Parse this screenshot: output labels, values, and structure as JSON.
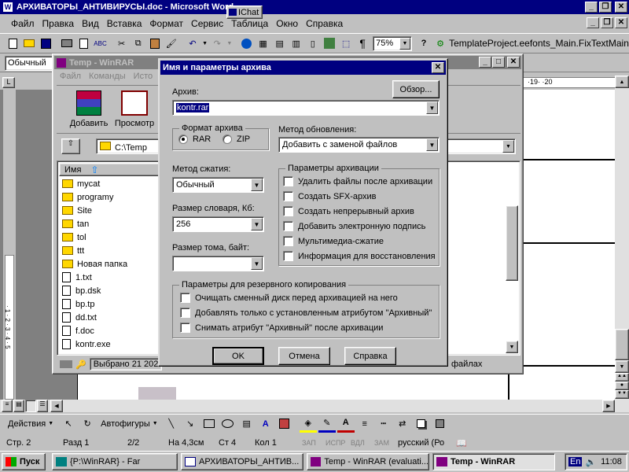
{
  "word": {
    "title": "АРХИВАТОРЫ_АНТИВИРУСЫ.doc - Microsoft Word",
    "menu": [
      "Файл",
      "Правка",
      "Вид",
      "Вставка",
      "Формат",
      "Сервис",
      "Таблица",
      "Окно",
      "Справка"
    ],
    "zoom": "75%",
    "macro": "TemplateProject.eefonts_Main.FixTextMain",
    "style": "Обычный",
    "ruler_marks": "·19·  ·20",
    "draw_label": "Действия",
    "autoshapes": "Автофигуры",
    "status": {
      "page": "Стр. 2",
      "section": "Разд 1",
      "pages": "2/2",
      "pos": "На 4,3см",
      "line": "Ст 4",
      "col": "Кол 1",
      "zap": "ЗАП",
      "ispr": "ИСПР",
      "vdl": "ВДЛ",
      "zam": "ЗАМ",
      "lang": "русский (Ро"
    }
  },
  "ichat": "IChat",
  "winrar": {
    "title": "Temp - WinRAR",
    "menu": [
      "Файл",
      "Команды",
      "Исто"
    ],
    "toolbar": [
      "Добавить",
      "Просмотр"
    ],
    "path": "C:\\Temp",
    "column_name": "Имя",
    "files": [
      {
        "name": "mycat",
        "type": "folder"
      },
      {
        "name": "programy",
        "type": "folder"
      },
      {
        "name": "Site",
        "type": "folder"
      },
      {
        "name": "tan",
        "type": "folder"
      },
      {
        "name": "tol",
        "type": "folder"
      },
      {
        "name": "ttt",
        "type": "folder"
      },
      {
        "name": "Новая папка",
        "type": "folder"
      },
      {
        "name": "1.txt",
        "type": "file"
      },
      {
        "name": "bp.dsk",
        "type": "file"
      },
      {
        "name": "bp.tp",
        "type": "file"
      },
      {
        "name": "dd.txt",
        "type": "file"
      },
      {
        "name": "f.doc",
        "type": "doc"
      },
      {
        "name": "kontr.exe",
        "type": "exe"
      }
    ],
    "status_left": "Выбрано 21 202",
    "status_right": "файлах"
  },
  "dialog": {
    "title": "Имя и параметры архива",
    "archive_label": "Архив:",
    "browse": "Обзор...",
    "archive_value": "kontr.rar",
    "format_group": "Формат архива",
    "format_rar": "RAR",
    "format_zip": "ZIP",
    "update_label": "Метод обновления:",
    "update_value": "Добавить с заменой файлов",
    "compression_label": "Метод сжатия:",
    "compression_value": "Обычный",
    "dict_label": "Размер словаря, Кб:",
    "dict_value": "256",
    "volume_label": "Размер тома, байт:",
    "volume_value": "",
    "options_group": "Параметры архивации",
    "options": [
      "Удалить файлы после архивации",
      "Создать SFX-архив",
      "Создать непрерывный архив",
      "Добавить электронную подпись",
      "Мультимедиа-сжатие",
      "Информация для восстановления"
    ],
    "backup_group": "Параметры для резервного копирования",
    "backup_options": [
      "Очищать сменный диск перед архивацией на него",
      "Добавлять только с установленным атрибутом \"Архивный\"",
      "Снимать атрибут \"Архивный\" после архивации"
    ],
    "ok": "OK",
    "cancel": "Отмена",
    "help": "Справка"
  },
  "taskbar": {
    "start": "Пуск",
    "items": [
      "{P:\\WinRAR} - Far",
      "АРХИВАТОРЫ_АНТИВ...",
      "Temp - WinRAR (evaluati...",
      "Temp - WinRAR"
    ],
    "lang": "En",
    "time": "11:08"
  },
  "colors": {
    "title_active": "#000080",
    "desktop_gray": "#c0c0c0"
  }
}
